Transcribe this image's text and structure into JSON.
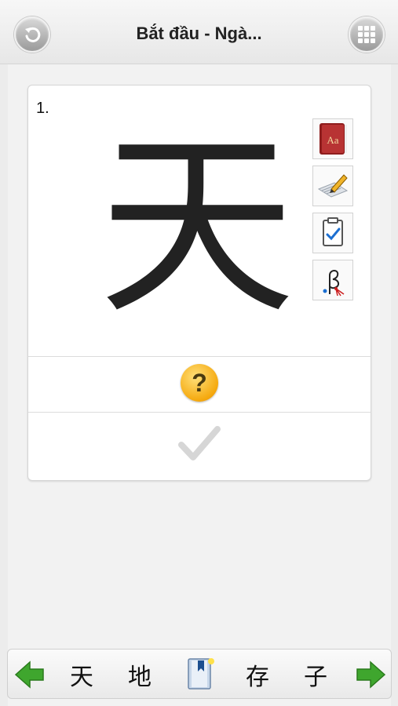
{
  "header": {
    "title": "Bắt đầu - Ngà...",
    "back_icon": "back-icon",
    "grid_icon": "grid-menu-icon"
  },
  "card": {
    "index": "1.",
    "kanji": "天",
    "tools": [
      "dictionary-icon",
      "write-icon",
      "quiz-clipboard-icon",
      "stroke-order-icon"
    ],
    "help_symbol": "?"
  },
  "bottom_bar": {
    "words": [
      "天",
      "地",
      "存",
      "子"
    ],
    "prev_icon": "prev-arrow-icon",
    "next_icon": "next-arrow-icon",
    "bookmark_icon": "bookmark-icon"
  },
  "colors": {
    "arrow_green": "#3fa62e",
    "help_orange": "#f5a90f",
    "check_gray": "#d6d6d6"
  }
}
